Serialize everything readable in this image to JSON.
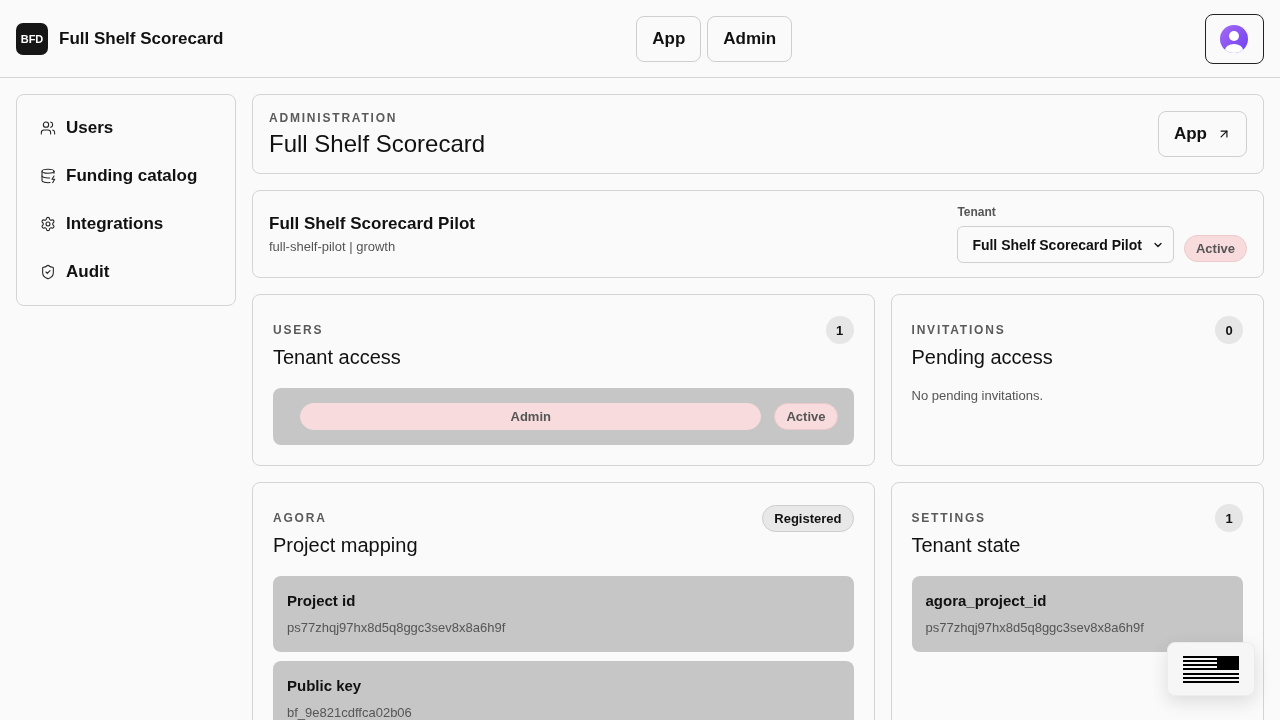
{
  "header": {
    "logo": "BFD",
    "title": "Full Shelf Scorecard",
    "nav": [
      {
        "label": "App"
      },
      {
        "label": "Admin"
      }
    ]
  },
  "sidebar": {
    "items": [
      {
        "label": "Users"
      },
      {
        "label": "Funding catalog"
      },
      {
        "label": "Integrations"
      },
      {
        "label": "Audit"
      }
    ]
  },
  "admin_header": {
    "eyebrow": "ADMINISTRATION",
    "title": "Full Shelf Scorecard",
    "button": "App"
  },
  "tenant": {
    "name": "Full Shelf Scorecard Pilot",
    "meta": "full-shelf-pilot | growth",
    "select_label": "Tenant",
    "select_value": "Full Shelf Scorecard Pilot",
    "status": "Active"
  },
  "panels": [
    {
      "kind": "users",
      "eyebrow": "USERS",
      "title": "Tenant access",
      "count": "1",
      "rows": [
        {
          "role": "Admin",
          "status": "Active"
        }
      ]
    },
    {
      "kind": "empty",
      "eyebrow": "INVITATIONS",
      "title": "Pending access",
      "count": "0",
      "message": "No pending invitations."
    },
    {
      "kind": "fields",
      "eyebrow": "AGORA",
      "title": "Project mapping",
      "badge": "Registered",
      "fields": [
        {
          "label": "Project id",
          "value": "ps77zhqj97hx8d5q8ggc3sev8x8a6h9f"
        },
        {
          "label": "Public key",
          "value": "bf_9e821cdffca02b06"
        }
      ]
    },
    {
      "kind": "fields",
      "eyebrow": "SETTINGS",
      "title": "Tenant state",
      "count": "1",
      "fields": [
        {
          "label": "agora_project_id",
          "value": "ps77zhqj97hx8d5q8ggc3sev8x8a6h9f"
        }
      ]
    }
  ]
}
